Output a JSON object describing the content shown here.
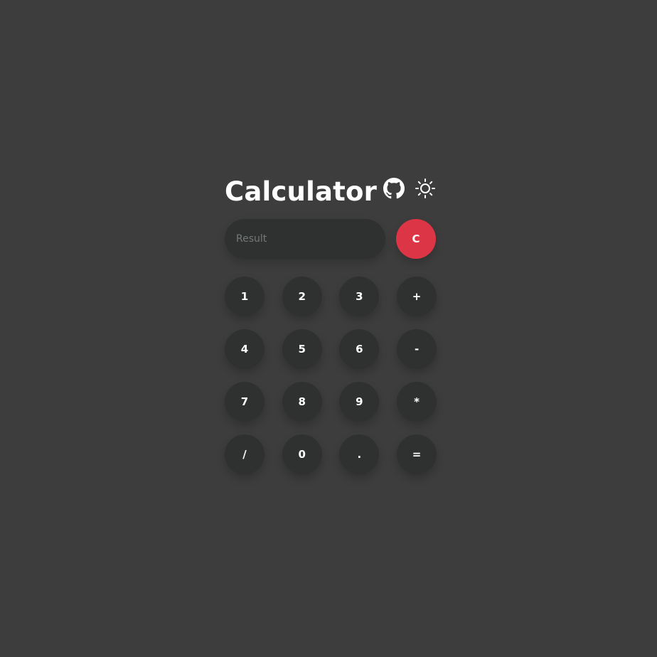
{
  "header": {
    "title": "Calculator",
    "github_icon": "github-icon",
    "theme_icon": "sun-icon"
  },
  "display": {
    "placeholder": "Result",
    "value": "",
    "clear_label": "C"
  },
  "keys": [
    {
      "label": "1",
      "name": "key-1"
    },
    {
      "label": "2",
      "name": "key-2"
    },
    {
      "label": "3",
      "name": "key-3"
    },
    {
      "label": "+",
      "name": "key-plus"
    },
    {
      "label": "4",
      "name": "key-4"
    },
    {
      "label": "5",
      "name": "key-5"
    },
    {
      "label": "6",
      "name": "key-6"
    },
    {
      "label": "-",
      "name": "key-minus"
    },
    {
      "label": "7",
      "name": "key-7"
    },
    {
      "label": "8",
      "name": "key-8"
    },
    {
      "label": "9",
      "name": "key-9"
    },
    {
      "label": "*",
      "name": "key-multiply"
    },
    {
      "label": "/",
      "name": "key-divide"
    },
    {
      "label": "0",
      "name": "key-0"
    },
    {
      "label": ".",
      "name": "key-decimal"
    },
    {
      "label": "=",
      "name": "key-equals"
    }
  ],
  "colors": {
    "background": "#3d3d3d",
    "button": "#2f3131",
    "clear": "#dc3545",
    "text": "#ffffff",
    "placeholder": "#757878"
  }
}
